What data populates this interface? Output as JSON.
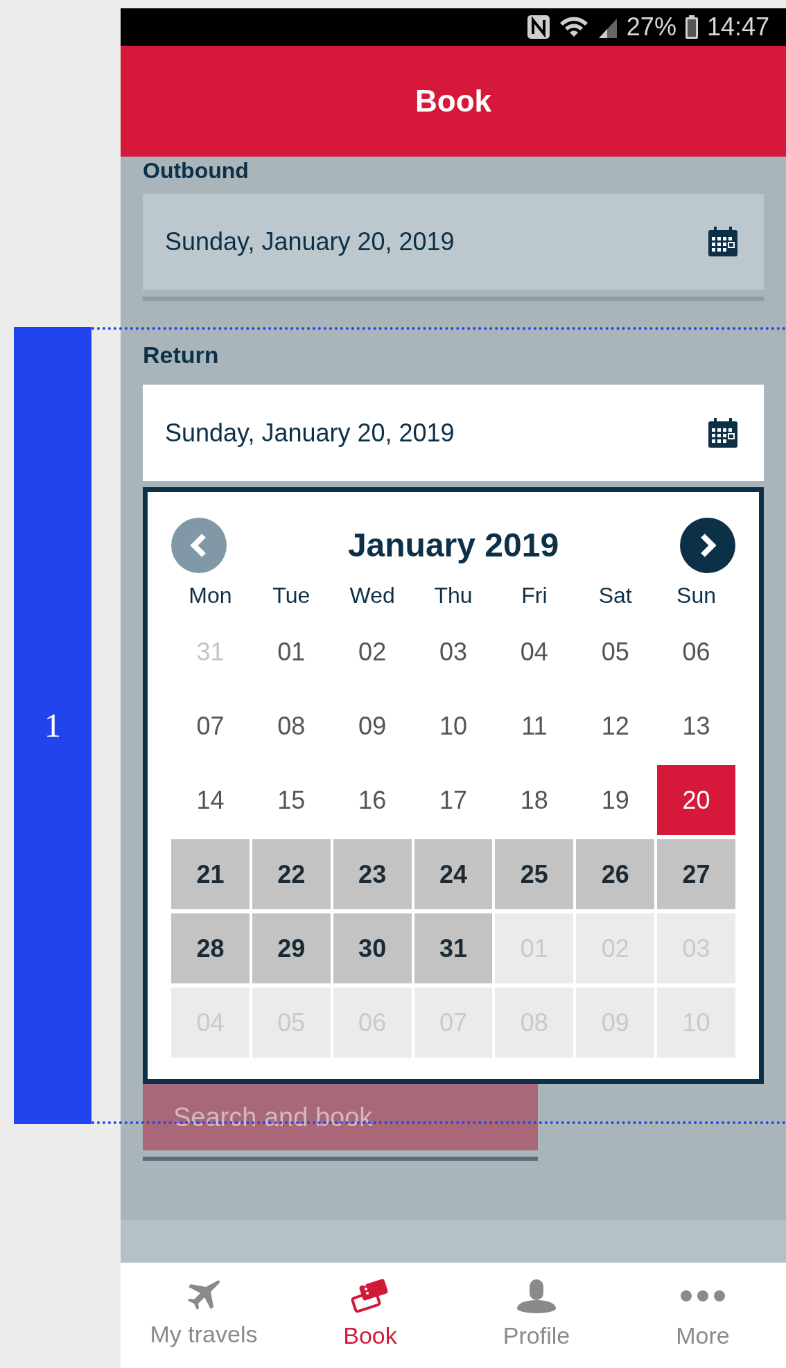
{
  "status_bar": {
    "battery": "27%",
    "time": "14:47"
  },
  "header": {
    "title": "Book"
  },
  "outbound": {
    "label": "Outbound",
    "value": "Sunday, January 20, 2019"
  },
  "return": {
    "label": "Return",
    "value": "Sunday, January 20, 2019"
  },
  "calendar": {
    "title": "January 2019",
    "prev": {
      "disabled": true
    },
    "next": {
      "disabled": false
    },
    "weekdays": [
      "Mon",
      "Tue",
      "Wed",
      "Thu",
      "Fri",
      "Sat",
      "Sun"
    ],
    "days": [
      {
        "label": "31",
        "kind": "muted"
      },
      {
        "label": "01",
        "kind": "normal"
      },
      {
        "label": "02",
        "kind": "normal"
      },
      {
        "label": "03",
        "kind": "normal"
      },
      {
        "label": "04",
        "kind": "normal"
      },
      {
        "label": "05",
        "kind": "normal"
      },
      {
        "label": "06",
        "kind": "normal"
      },
      {
        "label": "07",
        "kind": "normal"
      },
      {
        "label": "08",
        "kind": "normal"
      },
      {
        "label": "09",
        "kind": "normal"
      },
      {
        "label": "10",
        "kind": "normal"
      },
      {
        "label": "11",
        "kind": "normal"
      },
      {
        "label": "12",
        "kind": "normal"
      },
      {
        "label": "13",
        "kind": "normal"
      },
      {
        "label": "14",
        "kind": "normal"
      },
      {
        "label": "15",
        "kind": "normal"
      },
      {
        "label": "16",
        "kind": "normal"
      },
      {
        "label": "17",
        "kind": "normal"
      },
      {
        "label": "18",
        "kind": "normal"
      },
      {
        "label": "19",
        "kind": "normal"
      },
      {
        "label": "20",
        "kind": "selected"
      },
      {
        "label": "21",
        "kind": "range"
      },
      {
        "label": "22",
        "kind": "range"
      },
      {
        "label": "23",
        "kind": "range"
      },
      {
        "label": "24",
        "kind": "range"
      },
      {
        "label": "25",
        "kind": "range"
      },
      {
        "label": "26",
        "kind": "range"
      },
      {
        "label": "27",
        "kind": "range"
      },
      {
        "label": "28",
        "kind": "range"
      },
      {
        "label": "29",
        "kind": "range"
      },
      {
        "label": "30",
        "kind": "range"
      },
      {
        "label": "31",
        "kind": "range"
      },
      {
        "label": "01",
        "kind": "unavailable"
      },
      {
        "label": "02",
        "kind": "unavailable"
      },
      {
        "label": "03",
        "kind": "unavailable"
      },
      {
        "label": "04",
        "kind": "unavailable"
      },
      {
        "label": "05",
        "kind": "unavailable"
      },
      {
        "label": "06",
        "kind": "unavailable"
      },
      {
        "label": "07",
        "kind": "unavailable"
      },
      {
        "label": "08",
        "kind": "unavailable"
      },
      {
        "label": "09",
        "kind": "unavailable"
      },
      {
        "label": "10",
        "kind": "unavailable"
      }
    ]
  },
  "search_button": {
    "label": "Search and book",
    "disabled": true
  },
  "bottom_nav": [
    {
      "label": "My travels",
      "kind": "plane",
      "selected": false
    },
    {
      "label": "Book",
      "kind": "tickets",
      "selected": true
    },
    {
      "label": "Profile",
      "kind": "person",
      "selected": false
    },
    {
      "label": "More",
      "kind": "dots",
      "selected": false
    }
  ],
  "annotation": {
    "label": "1"
  }
}
